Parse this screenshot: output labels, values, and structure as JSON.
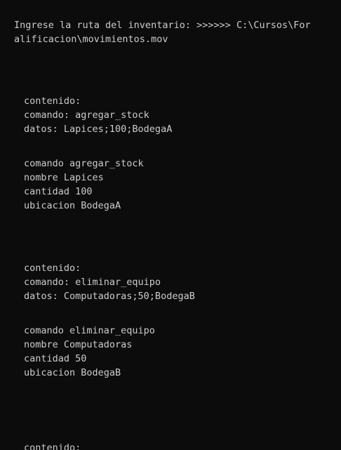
{
  "terminal": {
    "prompt_line_1": "Ingrese la ruta del inventario: >>>>>> C:\\Cursos\\For",
    "prompt_line_2": "alificacion\\movimientos.mov",
    "block1": {
      "header": "contenido:",
      "comando": "comando: agregar_stock",
      "datos": "datos: Lapices;100;BodegaA",
      "parsed_comando": "comando agregar_stock",
      "parsed_nombre": "nombre Lapices",
      "parsed_cantidad": "cantidad 100",
      "parsed_ubicacion": "ubicacion BodegaA"
    },
    "block2": {
      "header": "contenido:",
      "comando": "comando: eliminar_equipo",
      "datos": "datos: Computadoras;50;BodegaB",
      "parsed_comando": "comando eliminar_equipo",
      "parsed_nombre": "nombre Computadoras",
      "parsed_cantidad": "cantidad 50",
      "parsed_ubicacion": "ubicacion BodegaB"
    },
    "block3": {
      "header": "contenido:"
    }
  }
}
